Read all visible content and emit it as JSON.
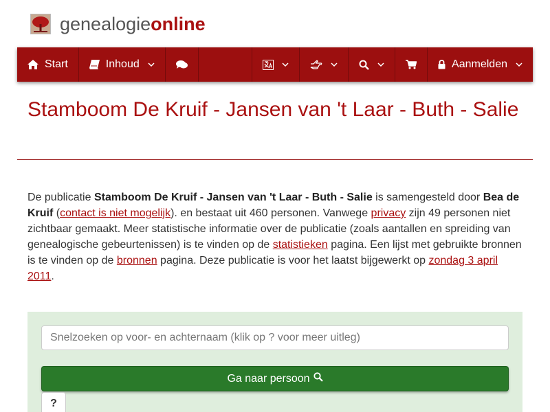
{
  "site": {
    "logo_text_part1": "genealogie",
    "logo_text_part2": "online",
    "brand_color": "#9c0f0f",
    "title_color": "#aa1111"
  },
  "nav": {
    "start_label": "Start",
    "inhoud_label": "Inhoud",
    "login_label": "Aanmelden",
    "icons": [
      "home-icon",
      "book-icon",
      "comments-icon",
      "language-icon",
      "hand-pointer-icon",
      "search-icon",
      "shopping-cart-icon",
      "lock-icon"
    ]
  },
  "page": {
    "title": "Stamboom De Kruif - Jansen van 't Laar - Buth - Salie"
  },
  "intro": {
    "t1": "De publicatie ",
    "pub_name": "Stamboom De Kruif - Jansen van 't Laar - Buth - Salie",
    "t2": " is samengesteld door ",
    "author": "Bea de Kruif",
    "t3": " (",
    "contact_link": "contact is niet mogelijk",
    "t4": "). en bestaat uit 460 personen. Vanwege ",
    "privacy_link": "privacy",
    "t5": " zijn 49 personen niet zichtbaar gemaakt. Meer statistische informatie over de publicatie (zoals aantallen en spreiding van genealogische gebeurtenissen) is te vinden op de ",
    "stats_link": "statistieken",
    "t6": " pagina. Een lijst met gebruikte bronnen is te vinden op de ",
    "sources_link": "bronnen",
    "t7": " pagina. Deze publicatie is voor het laatst bijgewerkt op ",
    "date_link": "zondag 3 april 2011",
    "t8": "."
  },
  "search": {
    "placeholder": "Snelzoeken op voor- en achternaam (klik op ? voor meer uitleg)",
    "go_label": "Ga naar persoon",
    "help_label": "?",
    "panel_color": "#dfeedd",
    "button_color": "#2a7a2a"
  }
}
